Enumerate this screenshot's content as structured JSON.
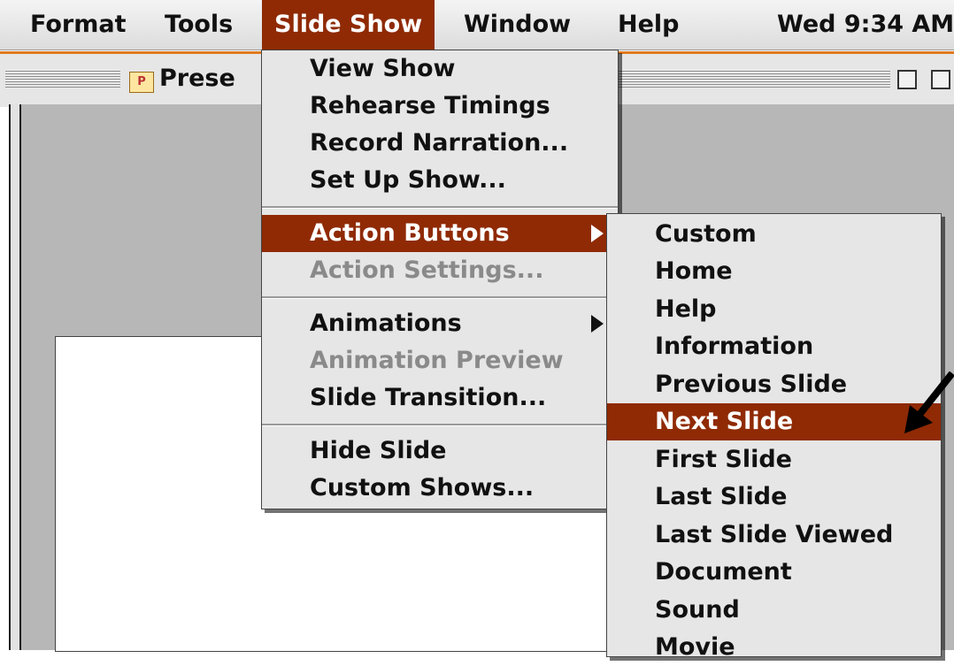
{
  "menubar": {
    "items": [
      {
        "label": "Format",
        "active": false
      },
      {
        "label": "Tools",
        "active": false
      },
      {
        "label": "Slide Show",
        "active": true
      },
      {
        "label": "Window",
        "active": false
      },
      {
        "label": "Help",
        "active": false
      }
    ],
    "clock": "Wed 9:34 AM"
  },
  "window": {
    "title": "Prese",
    "icon": "powerpoint-document-icon"
  },
  "slide_show_menu": {
    "items": [
      {
        "label": "View Show",
        "enabled": true
      },
      {
        "label": "Rehearse Timings",
        "enabled": true
      },
      {
        "label": "Record Narration...",
        "enabled": true
      },
      {
        "label": "Set Up Show...",
        "enabled": true
      },
      {
        "label": "Action Buttons",
        "enabled": true,
        "highlighted": true,
        "submenu": true
      },
      {
        "label": "Action Settings...",
        "enabled": false
      },
      {
        "label": "Animations",
        "enabled": true,
        "submenu": true
      },
      {
        "label": "Animation Preview",
        "enabled": false
      },
      {
        "label": "Slide Transition...",
        "enabled": true
      },
      {
        "label": "Hide Slide",
        "enabled": true
      },
      {
        "label": "Custom Shows...",
        "enabled": true
      }
    ]
  },
  "action_buttons_submenu": {
    "items": [
      {
        "label": "Custom"
      },
      {
        "label": "Home"
      },
      {
        "label": "Help"
      },
      {
        "label": "Information"
      },
      {
        "label": "Previous Slide"
      },
      {
        "label": "Next Slide",
        "highlighted": true
      },
      {
        "label": "First Slide"
      },
      {
        "label": "Last Slide"
      },
      {
        "label": "Last Slide Viewed"
      },
      {
        "label": "Document"
      },
      {
        "label": "Sound"
      },
      {
        "label": "Movie"
      }
    ]
  },
  "colors": {
    "highlight": "#8f2a04",
    "menu_background": "#e6e6e6",
    "accent_stripe": "#e07a20"
  }
}
